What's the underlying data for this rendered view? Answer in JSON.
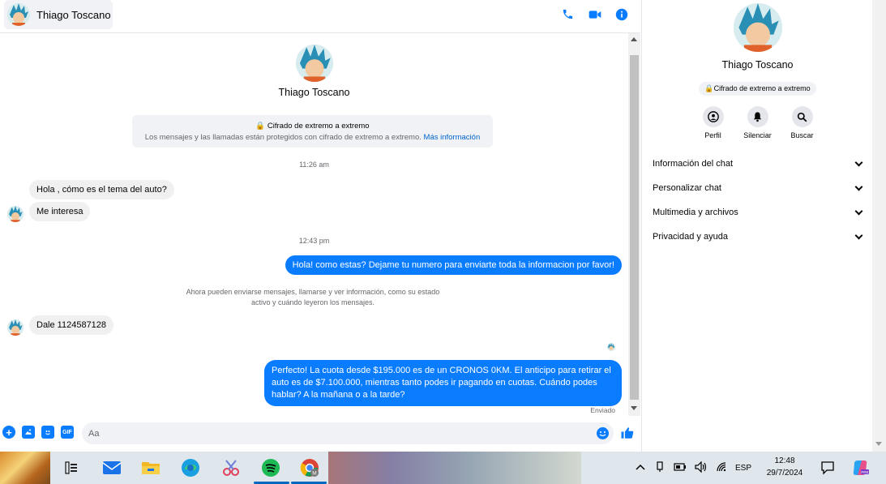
{
  "contact": {
    "name": "Thiago Toscano"
  },
  "colors": {
    "accent": "#0a7cff",
    "bubble_in": "#f0f0f0",
    "link": "#0064d1"
  },
  "header": {
    "icons": [
      "phone-icon",
      "video-call-icon",
      "info-icon"
    ]
  },
  "chat": {
    "profile_name": "Thiago Toscano",
    "encryption_title": "Cifrado de extremo a extremo",
    "encryption_desc": "Los mensajes y las llamadas están protegidos con cifrado de extremo a extremo.",
    "encryption_link": "Más información",
    "time1": "11:26 am",
    "msg1": "Hola , cómo es el tema del auto?",
    "msg2": "Me interesa",
    "time2": "12:43 pm",
    "msg3": "Hola! como estas? Dejame tu numero para enviarte toda la informacion por favor!",
    "system_line1": "Ahora pueden enviarse mensajes, llamarse y ver información, como su estado",
    "system_line2": "activo y cuándo leyeron los mensajes.",
    "msg4": "Dale 1124587128",
    "msg5": "Perfecto! La cuota desde $195.000 es de un CRONOS 0KM. El anticipo para retirar el auto es de $7.100.000, mientras tanto podes ir pagando en cuotas. Cuándo podes hablar? A la mañana o a la tarde?",
    "status": "Enviado"
  },
  "composer": {
    "placeholder": "Aa",
    "gif_label": "GIF"
  },
  "side": {
    "name": "Thiago Toscano",
    "encryption": "Cifrado de extremo a extremo",
    "actions": [
      {
        "label": "Perfil",
        "icon": "profile-icon"
      },
      {
        "label": "Silenciar",
        "icon": "bell-icon"
      },
      {
        "label": "Buscar",
        "icon": "search-icon"
      }
    ],
    "menu": [
      {
        "label": "Información del chat"
      },
      {
        "label": "Personalizar chat"
      },
      {
        "label": "Multimedia y archivos"
      },
      {
        "label": "Privacidad y ayuda"
      }
    ]
  },
  "taskbar": {
    "lang": "ESP",
    "time": "12:48",
    "date": "29/7/2024"
  }
}
